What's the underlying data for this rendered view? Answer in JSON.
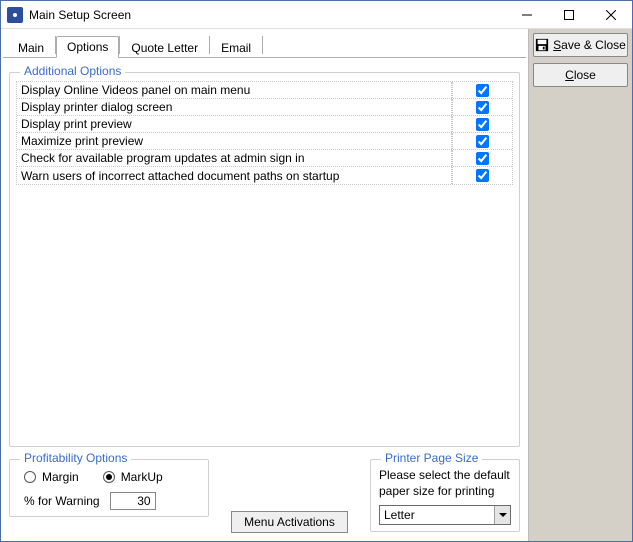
{
  "window": {
    "title": "Main Setup Screen"
  },
  "tabs": [
    {
      "label": "Main"
    },
    {
      "label": "Options"
    },
    {
      "label": "Quote Letter"
    },
    {
      "label": "Email"
    }
  ],
  "active_tab_index": 1,
  "right_panel": {
    "save_close_prefix_underline": "S",
    "save_close_rest": "ave & Close",
    "close_prefix_underline": "C",
    "close_rest": "lose"
  },
  "additional_options": {
    "legend": "Additional Options",
    "rows": [
      {
        "label": "Display Online Videos panel on main menu",
        "checked": true
      },
      {
        "label": "Display printer dialog screen",
        "checked": true
      },
      {
        "label": "Display print preview",
        "checked": true
      },
      {
        "label": "Maximize print preview",
        "checked": true
      },
      {
        "label": "Check for available program updates at admin sign in",
        "checked": true
      },
      {
        "label": "Warn users of incorrect attached document paths on startup",
        "checked": true
      }
    ]
  },
  "profitability": {
    "legend": "Profitability Options",
    "margin_label": "Margin",
    "markup_label": "MarkUp",
    "selected": "markup",
    "warn_label": "% for Warning",
    "warn_value": "30"
  },
  "menu_activations_label": "Menu Activations",
  "printer": {
    "legend": "Printer Page Size",
    "text": "Please select the default paper size for printing",
    "selected": "Letter"
  }
}
